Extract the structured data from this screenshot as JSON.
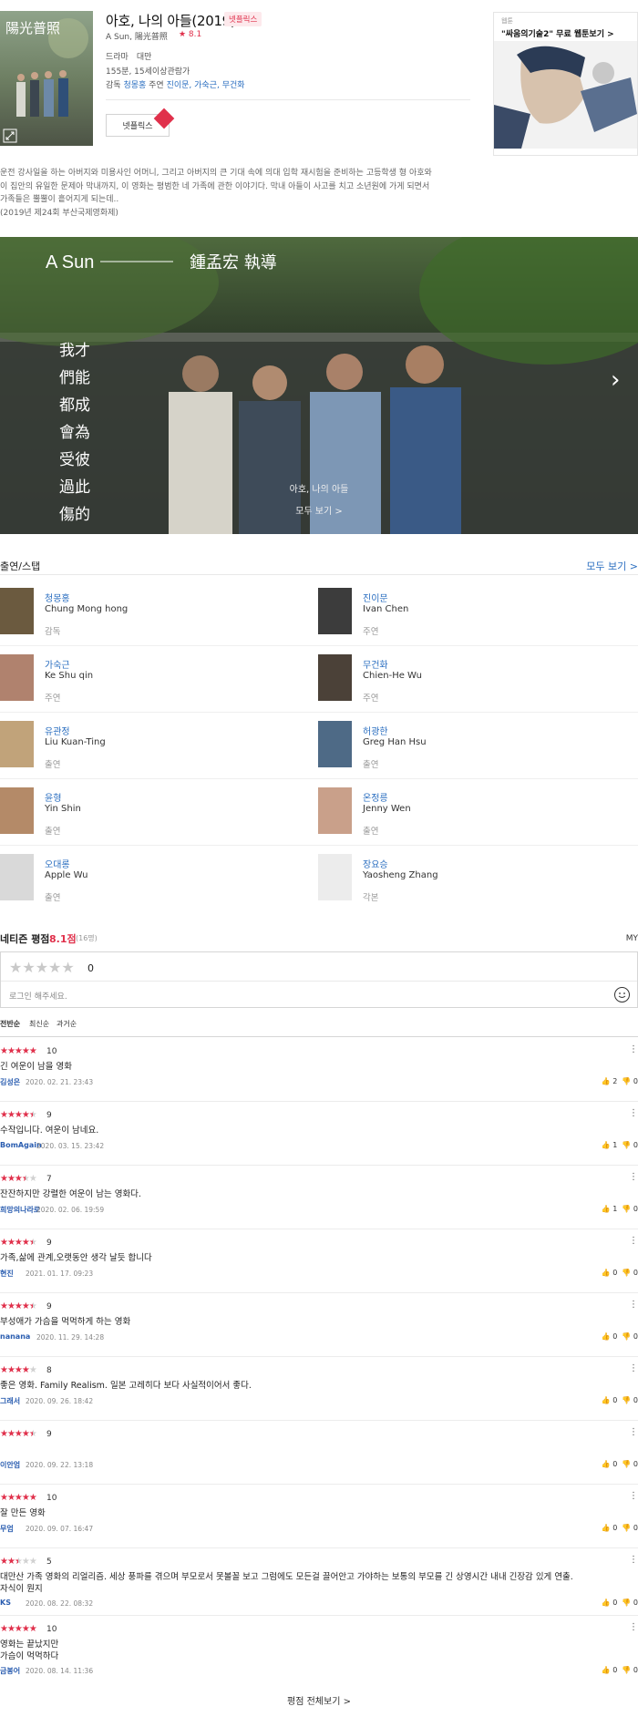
{
  "movie": {
    "title": "아호, 나의 아들(2019)",
    "badge": "넷플릭스",
    "subtitle": "A Sun, 陽光普照",
    "rating": "★ 8.1",
    "genre_country": "드라마　대만",
    "runtime_grade": "155분, 15세이상관람가",
    "director_label": "감독",
    "director": "청몽홍",
    "cast_label": "주연",
    "cast": "진이문, 가숙근, 무건화",
    "netflix_button": "넷플릭스",
    "poster_text": "陽光普照"
  },
  "ad": {
    "tag": "웹툰",
    "title": "\"싸움의기술2\" 무료 웹툰보기 >"
  },
  "synopsis": {
    "line1": "운전 강사일을 하는 아버지와 미용사인 어머니, 그리고 아버지의 큰 기대 속에 의대 입학 재시험을 준비하는 고등학생 형 아호와",
    "line2": "이 집안의 유일한 문제아 막내까지, 이 영화는 평범한 네 가족에 관한 이야기다. 막내 아들이 사고를 치고 소년원에 가게 되면서",
    "line3": "가족들은 뿔뿔이 흩어지게 되는데..",
    "line4": "(2019년 제24회 부산국제영화제)"
  },
  "still": {
    "caption_title": "아호, 나의 아들",
    "caption_link": "모두 보기 >",
    "overlay_en": "A Sun",
    "overlay_cn": "鍾孟宏 執導",
    "overlay_poem": [
      "我才",
      "們能",
      "都成",
      "會為",
      "受彼",
      "過此",
      "傷的"
    ]
  },
  "cast_section": {
    "title": "출연/스탭",
    "see_all": "모두 보기 >",
    "people": [
      {
        "kname": "청몽홍",
        "ename": "Chung Mong hong",
        "role": "감독"
      },
      {
        "kname": "진이문",
        "ename": "Ivan Chen",
        "role": "주연"
      },
      {
        "kname": "가숙근",
        "ename": "Ke Shu qin",
        "role": "주연"
      },
      {
        "kname": "무건화",
        "ename": "Chien-He Wu",
        "role": "주연"
      },
      {
        "kname": "유관정",
        "ename": "Liu Kuan-Ting",
        "role": "출연"
      },
      {
        "kname": "허광한",
        "ename": "Greg Han Hsu",
        "role": "출연"
      },
      {
        "kname": "윤형",
        "ename": "Yin Shin",
        "role": "출연"
      },
      {
        "kname": "온정릉",
        "ename": "Jenny Wen",
        "role": "출연"
      },
      {
        "kname": "오대롱",
        "ename": "Apple Wu",
        "role": "출연"
      },
      {
        "kname": "장요승",
        "ename": "Yaosheng Zhang",
        "role": "각본"
      }
    ]
  },
  "netizen": {
    "title": "네티즌 평점",
    "score": "8.1점",
    "count": "(16명)",
    "my": "MY",
    "rate_value": "0",
    "placeholder": "로그인 해주세요.",
    "sort": [
      "전반순",
      "최신순",
      "과거순"
    ]
  },
  "reviews": [
    {
      "stars": 5,
      "score": "10",
      "text": "긴 여운이 남을 영화",
      "user": "김성은",
      "date": "2020. 02. 21. 23:43",
      "like": "2",
      "dislike": "0"
    },
    {
      "stars": 4.5,
      "score": "9",
      "text": "수작입니다. 여운이 남네요.",
      "user": "BomAgain",
      "date": "2020. 03. 15. 23:42",
      "like": "1",
      "dislike": "0"
    },
    {
      "stars": 3.5,
      "score": "7",
      "text": "잔잔하지만 강렬한 여운이 남는 영화다.",
      "user": "희망의나라로",
      "date": "2020. 02. 06. 19:59",
      "like": "1",
      "dislike": "0"
    },
    {
      "stars": 4.5,
      "score": "9",
      "text": "가족,삶에 관계,오랫동안 생각  날듯  합니다",
      "user": "현진",
      "date": "2021. 01. 17. 09:23",
      "like": "0",
      "dislike": "0"
    },
    {
      "stars": 4.5,
      "score": "9",
      "text": "부성애가 가슴을 먹먹하게 하는 영화",
      "user": "nanana",
      "date": "2020. 11. 29. 14:28",
      "like": "0",
      "dislike": "0"
    },
    {
      "stars": 4,
      "score": "8",
      "text": "좋은 영화. Family Realism. 일본 고레히다 보다 사실적이어서 좋다.",
      "user": "그래서",
      "date": "2020. 09. 26. 18:42",
      "like": "0",
      "dislike": "0"
    },
    {
      "stars": 4.5,
      "score": "9",
      "text": "",
      "user": "이안엄",
      "date": "2020. 09. 22. 13:18",
      "like": "0",
      "dislike": "0"
    },
    {
      "stars": 5,
      "score": "10",
      "text": "잘 만든 영화",
      "user": "무엄",
      "date": "2020. 09. 07. 16:47",
      "like": "0",
      "dislike": "0"
    },
    {
      "stars": 2.5,
      "score": "5",
      "text": "대만산 가족 영화의 리얼리즘. 세상 풍파를 겪으며 부모로서 못볼꼴 보고 그럼에도 모든걸 끌어안고 가야하는 보통의 부모를 긴 상영시간 내내 긴장감 있게 연출.\n자식이 뭔지",
      "user": "KS",
      "date": "2020. 08. 22. 08:32",
      "like": "0",
      "dislike": "0"
    },
    {
      "stars": 5,
      "score": "10",
      "text": "영화는 끝났지만\n가슴이 먹먹하다",
      "user": "금봉어",
      "date": "2020. 08. 14. 11:36",
      "like": "0",
      "dislike": "0"
    }
  ],
  "footer": {
    "all_reviews": "평점 전체보기 >"
  },
  "colors": {
    "accent": "#e0304b",
    "link": "#2a6ec0"
  }
}
